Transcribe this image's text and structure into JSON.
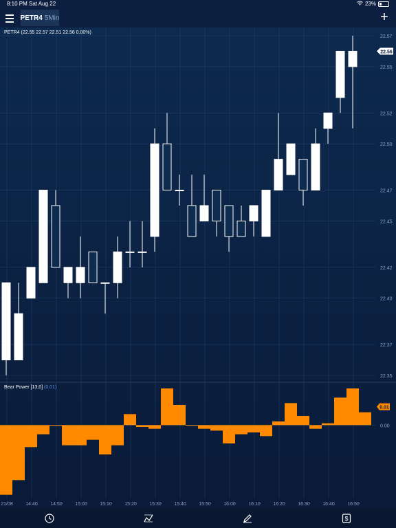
{
  "status_bar": {
    "time": "8:10 PM",
    "date": "Sat Aug 22",
    "battery": "23%"
  },
  "nav": {
    "symbol": "PETR4",
    "interval": "5Min"
  },
  "price_pane": {
    "legend_label": "PETR4 (22.55 22.57 22.51 22.56 0.00%)",
    "current_price": "22.56",
    "y_ticks": [
      "22.57",
      "22.55",
      "22.52",
      "22.50",
      "22.47",
      "22.45",
      "22.42",
      "22.40",
      "22.37",
      "22.35"
    ]
  },
  "indicator_pane": {
    "legend_label": "Bear Power [13,0]",
    "legend_value": "(0.01)",
    "current_value": "0.01",
    "y_ticks": [
      "0.00"
    ]
  },
  "x_axis": {
    "ticks": [
      "21/08",
      "14:40",
      "14:50",
      "15:00",
      "15:10",
      "15:20",
      "15:30",
      "15:40",
      "15:50",
      "16:00",
      "16:10",
      "16:20",
      "16:30",
      "16:40",
      "16:50"
    ]
  },
  "chart_data": [
    {
      "type": "candlestick",
      "title": "PETR4 (22.55 22.57 22.51 22.56 0.00%)",
      "ylim": [
        22.34,
        22.58
      ],
      "candles": [
        {
          "o": 22.36,
          "h": 22.41,
          "l": 22.35,
          "c": 22.41
        },
        {
          "o": 22.36,
          "h": 22.41,
          "l": 22.36,
          "c": 22.39
        },
        {
          "o": 22.4,
          "h": 22.42,
          "l": 22.4,
          "c": 22.42
        },
        {
          "o": 22.41,
          "h": 22.47,
          "l": 22.41,
          "c": 22.47
        },
        {
          "o": 22.46,
          "h": 22.47,
          "l": 22.42,
          "c": 22.42
        },
        {
          "o": 22.41,
          "h": 22.42,
          "l": 22.4,
          "c": 22.42
        },
        {
          "o": 22.41,
          "h": 22.44,
          "l": 22.4,
          "c": 22.42
        },
        {
          "o": 22.43,
          "h": 22.43,
          "l": 22.41,
          "c": 22.41
        },
        {
          "o": 22.41,
          "h": 22.41,
          "l": 22.39,
          "c": 22.41
        },
        {
          "o": 22.41,
          "h": 22.44,
          "l": 22.4,
          "c": 22.43
        },
        {
          "o": 22.43,
          "h": 22.45,
          "l": 22.42,
          "c": 22.43
        },
        {
          "o": 22.43,
          "h": 22.45,
          "l": 22.42,
          "c": 22.43
        },
        {
          "o": 22.44,
          "h": 22.51,
          "l": 22.43,
          "c": 22.5
        },
        {
          "o": 22.5,
          "h": 22.52,
          "l": 22.47,
          "c": 22.47
        },
        {
          "o": 22.47,
          "h": 22.48,
          "l": 22.46,
          "c": 22.47
        },
        {
          "o": 22.46,
          "h": 22.48,
          "l": 22.44,
          "c": 22.44
        },
        {
          "o": 22.45,
          "h": 22.48,
          "l": 22.45,
          "c": 22.46
        },
        {
          "o": 22.47,
          "h": 22.47,
          "l": 22.44,
          "c": 22.45
        },
        {
          "o": 22.46,
          "h": 22.46,
          "l": 22.43,
          "c": 22.44
        },
        {
          "o": 22.45,
          "h": 22.46,
          "l": 22.44,
          "c": 22.44
        },
        {
          "o": 22.45,
          "h": 22.46,
          "l": 22.44,
          "c": 22.46
        },
        {
          "o": 22.44,
          "h": 22.47,
          "l": 22.44,
          "c": 22.47
        },
        {
          "o": 22.47,
          "h": 22.52,
          "l": 22.47,
          "c": 22.49
        },
        {
          "o": 22.48,
          "h": 22.5,
          "l": 22.48,
          "c": 22.5
        },
        {
          "o": 22.49,
          "h": 22.49,
          "l": 22.46,
          "c": 22.47
        },
        {
          "o": 22.47,
          "h": 22.51,
          "l": 22.47,
          "c": 22.5
        },
        {
          "o": 22.51,
          "h": 22.52,
          "l": 22.5,
          "c": 22.52
        },
        {
          "o": 22.53,
          "h": 22.56,
          "l": 22.52,
          "c": 22.56
        },
        {
          "o": 22.55,
          "h": 22.57,
          "l": 22.51,
          "c": 22.56
        }
      ]
    },
    {
      "type": "bar",
      "title": "Bear Power [13,0] (0.01)",
      "color": "#ff8a00",
      "ylim": [
        -0.04,
        0.02
      ],
      "values": [
        -0.038,
        -0.03,
        -0.012,
        -0.005,
        0.0,
        -0.011,
        -0.011,
        -0.008,
        -0.016,
        -0.011,
        0.006,
        -0.001,
        -0.002,
        0.02,
        0.011,
        0.0,
        -0.002,
        -0.003,
        -0.01,
        -0.005,
        -0.004,
        -0.006,
        0.002,
        0.012,
        0.005,
        -0.002,
        0.001,
        0.015,
        0.02,
        0.007
      ]
    }
  ]
}
